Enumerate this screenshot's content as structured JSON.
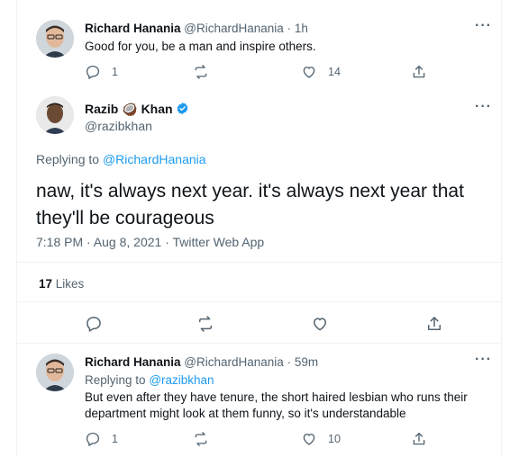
{
  "tweet1": {
    "name": "Richard Hanania",
    "handle": "@RichardHanania",
    "separator": "·",
    "time": "1h",
    "text": "Good for you, be a man and inspire others.",
    "reply_count": "1",
    "like_count": "14"
  },
  "main_tweet": {
    "name_before": "Razib",
    "emoji": "🥥",
    "name_after": "Khan",
    "handle": "@razibkhan",
    "replying_label": "Replying to",
    "replying_to": "@RichardHanania",
    "text": "naw, it's always next year. it's always next year that they'll be courageous",
    "timestamp": "7:18 PM · Aug 8, 2021 · Twitter Web App",
    "likes_count": "17",
    "likes_label": "Likes"
  },
  "tweet3": {
    "name": "Richard Hanania",
    "handle": "@RichardHanania",
    "separator": "·",
    "time": "59m",
    "replying_label": "Replying to",
    "replying_to": "@razibkhan",
    "text": "But even after they have tenure, the short haired lesbian who runs their department might look at them funny, so it's understandable",
    "reply_count": "1",
    "like_count": "10"
  },
  "more_label": "···",
  "colors": {
    "accent": "#1d9bf0",
    "muted": "#536471",
    "divider": "#eff3f4",
    "verified": "#1d9bf0"
  }
}
